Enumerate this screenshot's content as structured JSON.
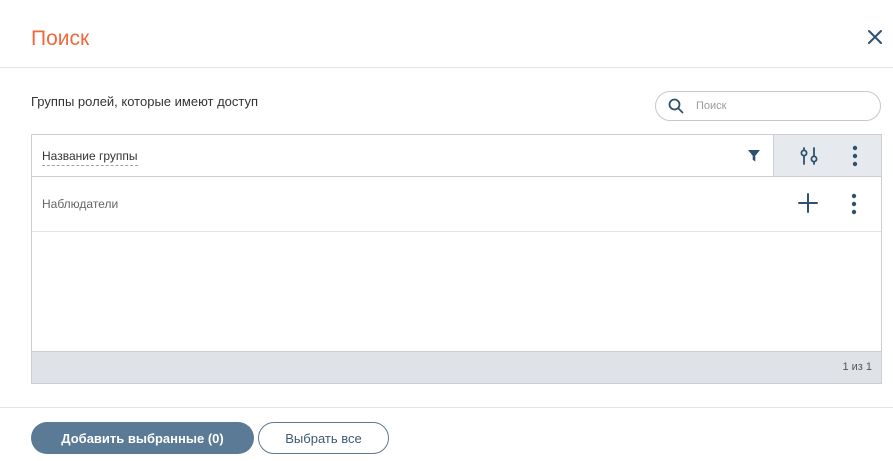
{
  "dialog": {
    "title": "Поиск"
  },
  "section": {
    "label": "Группы ролей, которые имеют доступ"
  },
  "search": {
    "placeholder": "Поиск",
    "value": ""
  },
  "grid": {
    "columns": [
      "Название группы"
    ],
    "rows": [
      {
        "label": "Наблюдатели"
      }
    ],
    "pager": "1 из 1"
  },
  "footer": {
    "add_selected_label": "Добавить выбранные (0)",
    "select_all_label": "Выбрать все"
  },
  "icons": {
    "close": "close-icon",
    "search": "search-icon",
    "filter": "filter-icon",
    "settings": "column-settings-icon",
    "more": "more-vertical-icon",
    "add": "plus-icon"
  },
  "colors": {
    "title": "#ee6a3c",
    "accent": "#5a7a95",
    "icon": "#2e5170",
    "header_tools_bg": "#e6eaee",
    "footer_bg": "#dfe3e7"
  }
}
